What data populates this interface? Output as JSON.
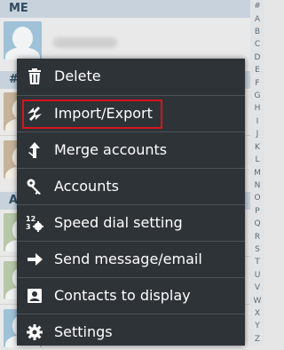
{
  "list": {
    "me_header": "ME",
    "hash_header": "#",
    "a_header": "A"
  },
  "index_letters": [
    "#",
    "A",
    "B",
    "C",
    "D",
    "E",
    "F",
    "G",
    "H",
    "I",
    "J",
    "K",
    "L",
    "M",
    "N",
    "O",
    "P",
    "Q",
    "R",
    "S",
    "T",
    "U",
    "V",
    "W",
    "X",
    "Y",
    "Z"
  ],
  "menu": {
    "items": [
      {
        "label": "Delete",
        "icon": "trash-icon"
      },
      {
        "label": "Import/Export",
        "icon": "import-export-icon"
      },
      {
        "label": "Merge accounts",
        "icon": "merge-icon"
      },
      {
        "label": "Accounts",
        "icon": "key-icon"
      },
      {
        "label": "Speed dial setting",
        "icon": "speed-dial-icon"
      },
      {
        "label": "Send message/email",
        "icon": "arrow-right-icon"
      },
      {
        "label": "Contacts to display",
        "icon": "contact-card-icon"
      },
      {
        "label": "Settings",
        "icon": "gear-icon"
      }
    ],
    "highlighted_item": "Import/Export",
    "highlight_color": "#d6141e"
  }
}
